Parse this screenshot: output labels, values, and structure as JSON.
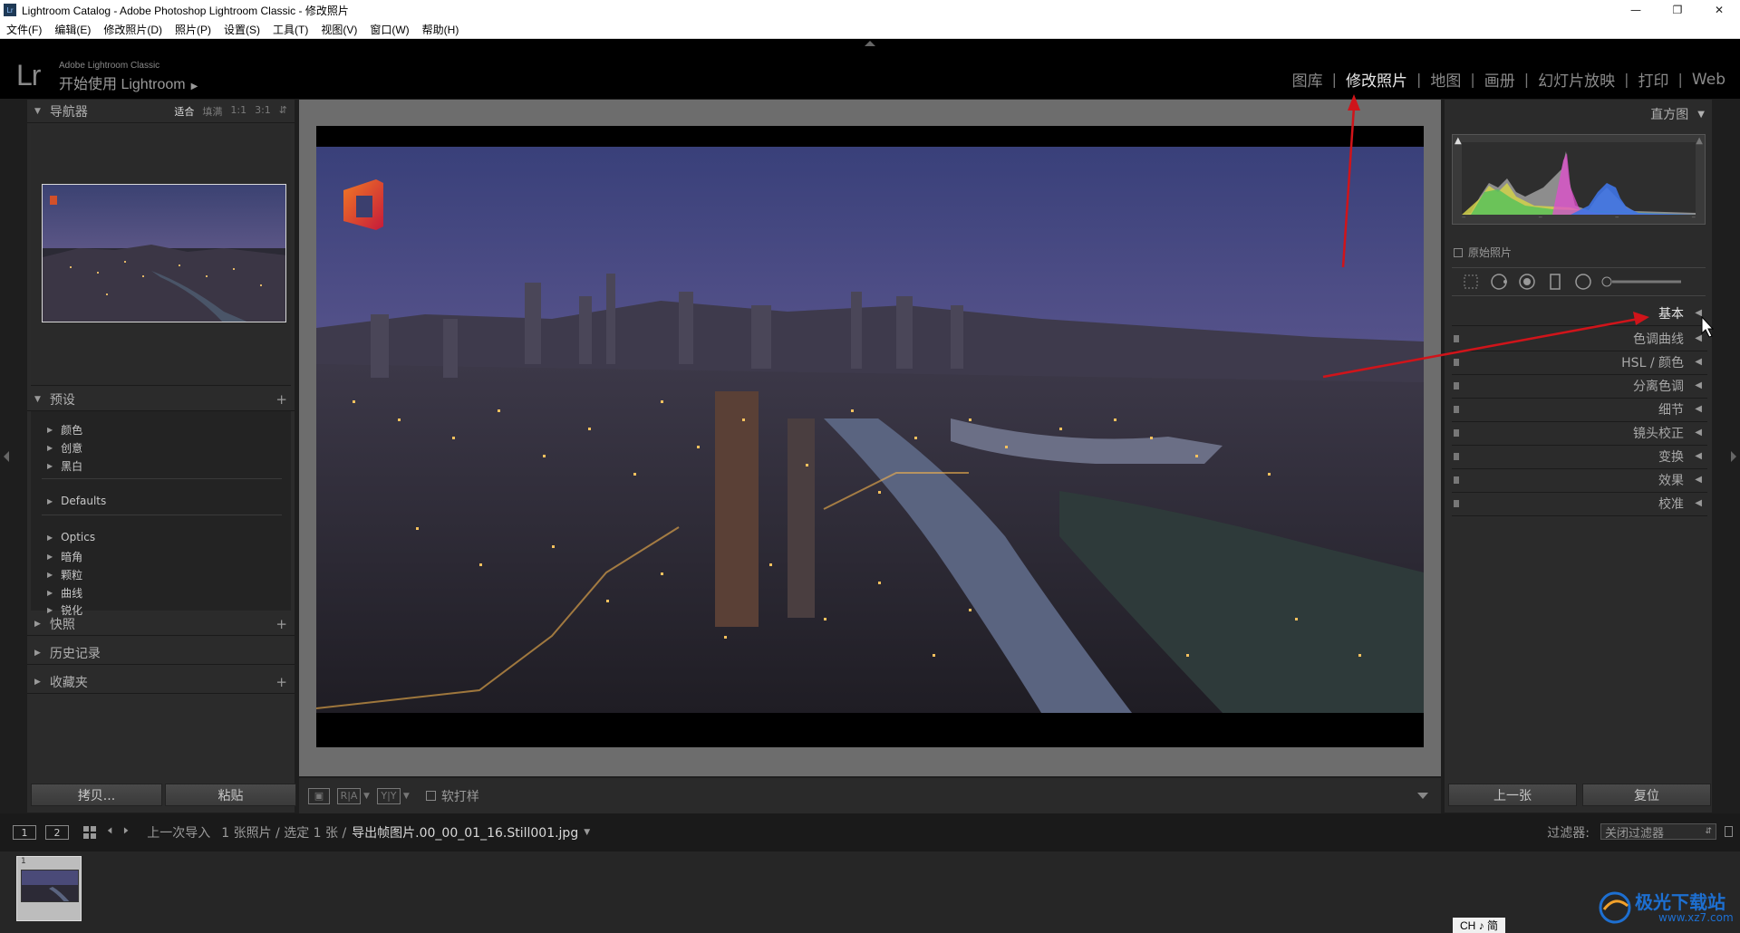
{
  "window": {
    "title": "Lightroom Catalog - Adobe Photoshop Lightroom Classic - 修改照片",
    "icon_label": "Lr",
    "controls": [
      "minimize-icon",
      "restore-icon",
      "close-icon"
    ]
  },
  "menubar": [
    "文件(F)",
    "编辑(E)",
    "修改照片(D)",
    "照片(P)",
    "设置(S)",
    "工具(T)",
    "视图(V)",
    "窗口(W)",
    "帮助(H)"
  ],
  "identity": {
    "logo": "Lr",
    "product": "Adobe Lightroom Classic",
    "prompt": "开始使用 Lightroom"
  },
  "modules": [
    "图库",
    "修改照片",
    "地图",
    "画册",
    "幻灯片放映",
    "打印",
    "Web"
  ],
  "active_module": "修改照片",
  "left_panel": {
    "navigator": {
      "title": "导航器",
      "options": [
        "适合",
        "填满",
        "1:1",
        "3:1"
      ],
      "active_option": "适合"
    },
    "presets": {
      "title": "预设",
      "groups": [
        [
          "颜色",
          "创意",
          "黑白"
        ],
        [
          "Defaults"
        ],
        [
          "Optics",
          "暗角",
          "颗粒",
          "曲线",
          "锐化"
        ]
      ]
    },
    "snapshots": "快照",
    "history": "历史记录",
    "collections": "收藏夹",
    "copy_button": "拷贝...",
    "paste_button": "粘贴"
  },
  "toolbar": {
    "ra_label": "R|A",
    "yy_label": "Y|Y",
    "soft_proof_label": "软打样"
  },
  "right_panel": {
    "histogram_title": "直方图",
    "original_photo_label": "原始照片",
    "sections": [
      "基本",
      "色调曲线",
      "HSL / 颜色",
      "分离色调",
      "细节",
      "镜头校正",
      "变换",
      "效果",
      "校准"
    ],
    "active_section": "基本",
    "previous_button": "上一张",
    "reset_button": "复位"
  },
  "filmstrip": {
    "pages": [
      "1",
      "2"
    ],
    "source": "上一次导入",
    "count": "1 张照片 / 选定 1 张 /",
    "filename": "导出帧图片.00_00_01_16.Still001.jpg",
    "filter_label": "过滤器:",
    "filter_value": "关闭过滤器",
    "thumb_number": "1"
  },
  "ime": "CH ♪ 简",
  "watermark": {
    "text": "极光下载站",
    "url": "www.xz7.com"
  },
  "colors": {
    "annotation_arrow": "#d0141a",
    "panel_bg": "#2b2b2b",
    "center_bg": "#6d6d6d"
  }
}
